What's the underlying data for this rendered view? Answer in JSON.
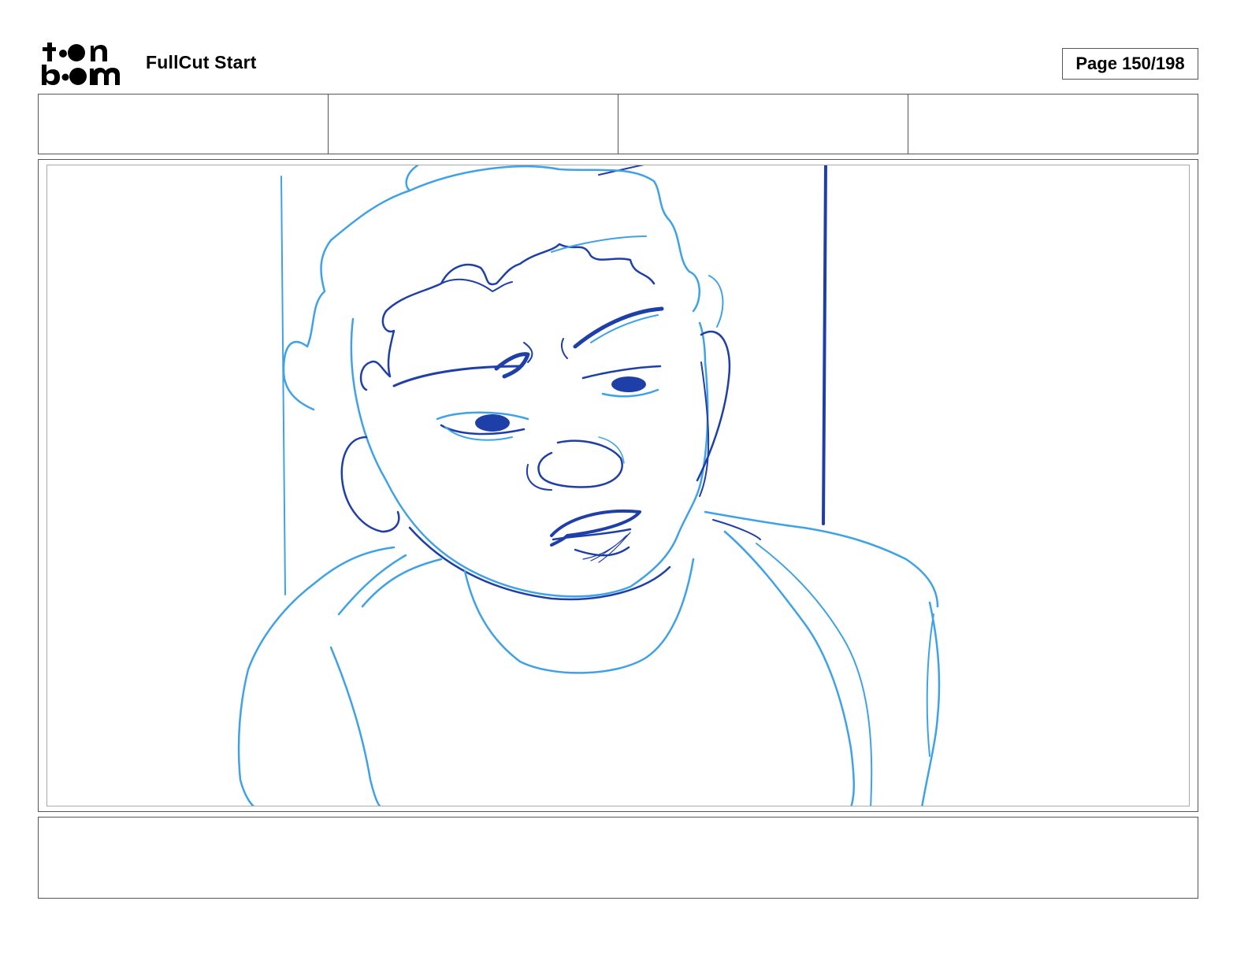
{
  "header": {
    "logo_text": "toon boom",
    "project_title": "FullCut Start",
    "page_counter": "Page 150/198"
  },
  "colors": {
    "sketch_light": "#3fa2e6",
    "sketch_dark": "#1f3fa8",
    "frame_border": "#555555"
  }
}
